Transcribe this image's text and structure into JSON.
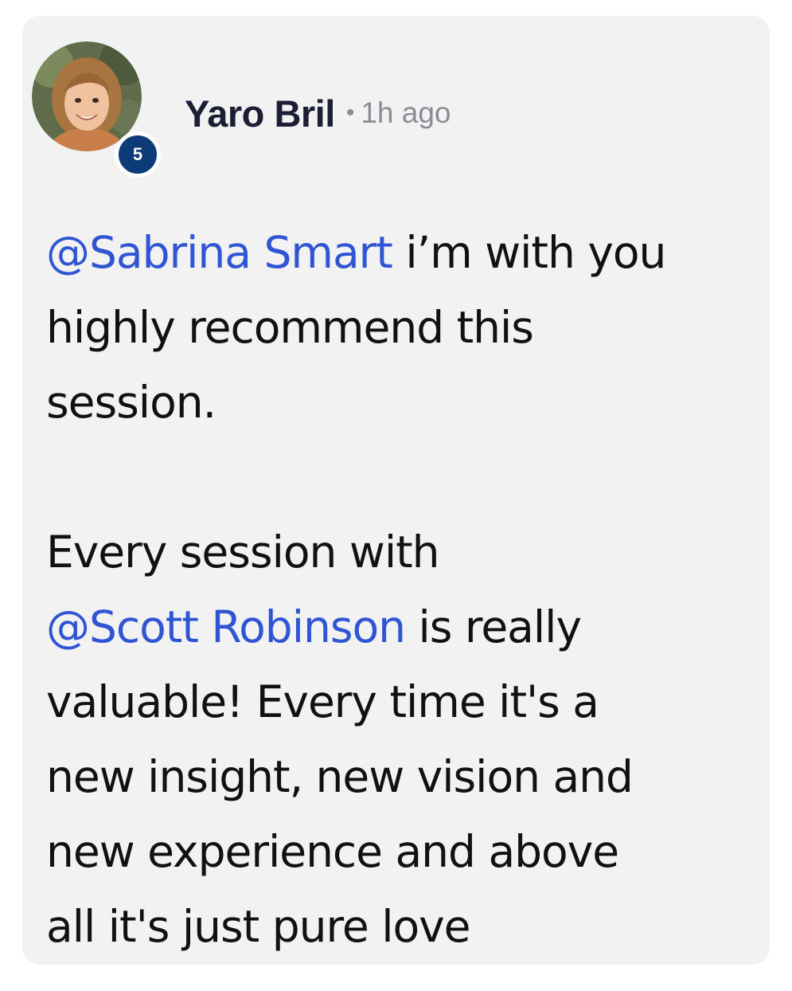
{
  "post": {
    "author": "Yaro Bril",
    "level": "5",
    "separator": "•",
    "time": "1h ago",
    "colors": {
      "mention": "#2f55d4",
      "badge": "#0d3b78",
      "card_background": "#f2f2f3"
    },
    "paragraph1": {
      "mention": "@Sabrina Smart",
      "line1_rest": " i’m with you",
      "line2": "highly recommend this",
      "line3": "session."
    },
    "paragraph2": {
      "line1": "Every session with",
      "mention": "@Scott Robinson",
      "line2_rest": " is really",
      "line3": "valuable! Every time it's a",
      "line4": "new insight, new vision and",
      "line5": "new experience and above",
      "line6": "all it's just pure love"
    }
  }
}
